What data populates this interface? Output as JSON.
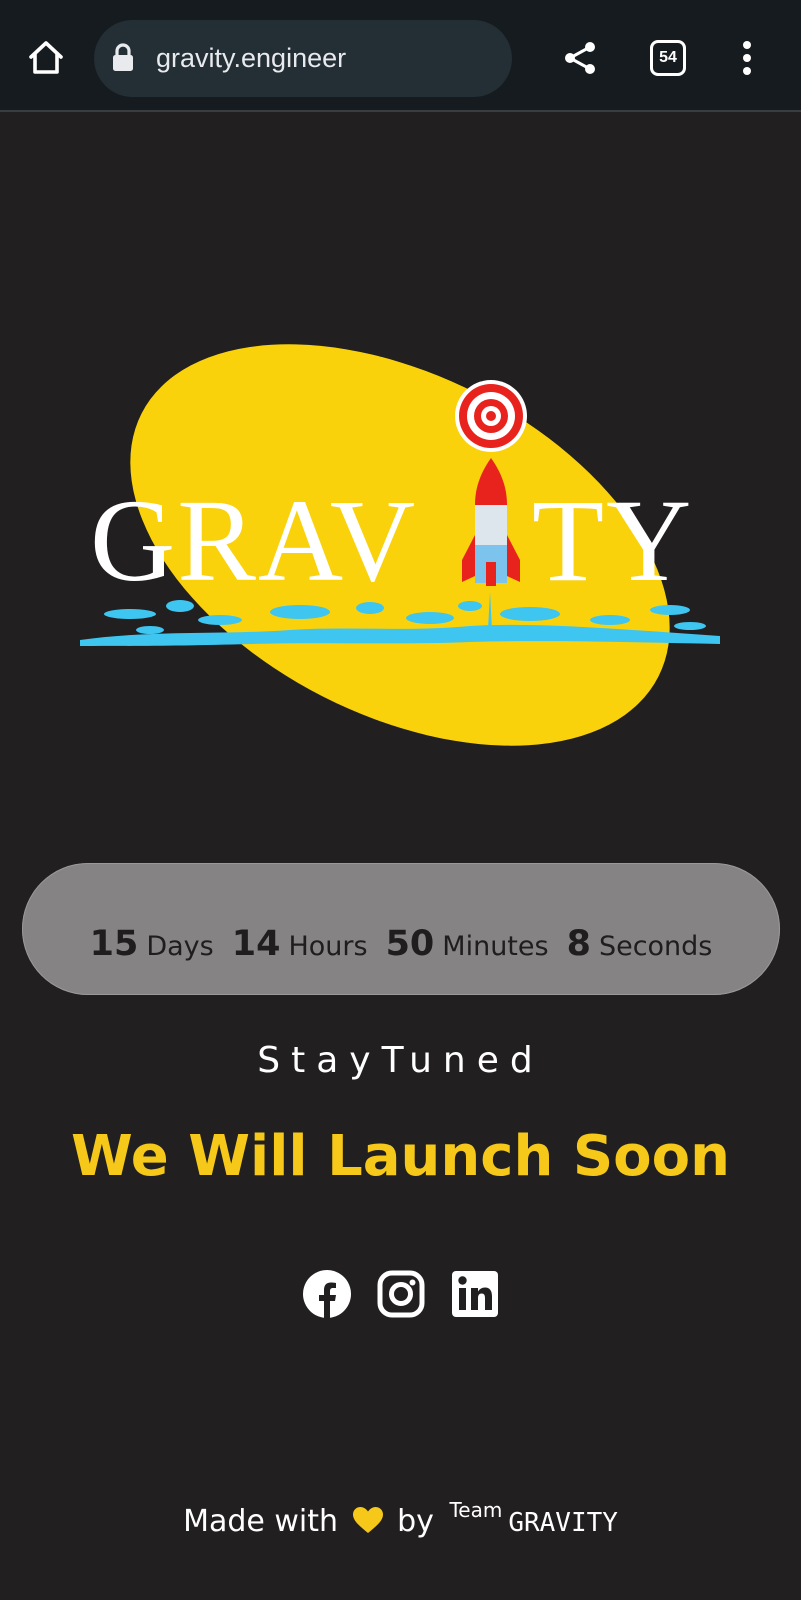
{
  "browser": {
    "url": "gravity.engineer",
    "tab_count": "54",
    "icons": {
      "home": "home-icon",
      "lock": "lock-icon",
      "share": "share-icon",
      "menu": "more-vert-icon"
    }
  },
  "logo": {
    "text": "GRAVITY",
    "colors": {
      "ellipse": "#f9d20c",
      "water": "#3ec5f0",
      "rocket": "#e8231e",
      "text": "#ffffff"
    }
  },
  "countdown": {
    "units": [
      {
        "value": "15",
        "label": "Days"
      },
      {
        "value": "14",
        "label": "Hours"
      },
      {
        "value": "50",
        "label": "Minutes"
      },
      {
        "value": "8",
        "label": "Seconds"
      }
    ]
  },
  "hero": {
    "stay_tuned": "StayTuned",
    "launch_soon": "We Will Launch Soon",
    "accent_color": "#f6c81a"
  },
  "socials": [
    {
      "name": "facebook-icon"
    },
    {
      "name": "instagram-icon"
    },
    {
      "name": "linkedin-icon"
    }
  ],
  "footer": {
    "made_with": "Made with",
    "by": "by",
    "team_label": "Team",
    "team_name": "GRAVITY"
  }
}
